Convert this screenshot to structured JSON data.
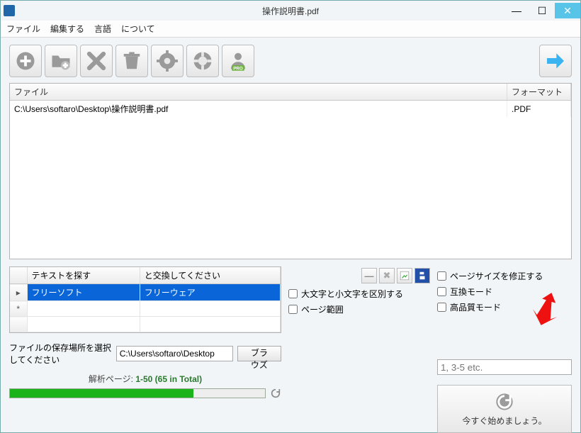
{
  "window": {
    "title": "操作説明書.pdf"
  },
  "menubar": {
    "file": "ファイル",
    "edit": "編集する",
    "language": "言語",
    "about": "について"
  },
  "toolbar_icons": {
    "add": "add-icon",
    "add_folder": "add-folder-icon",
    "remove": "remove-icon",
    "trash": "trash-icon",
    "settings": "gear-icon",
    "help": "lifebuoy-icon",
    "pro": "pro-icon",
    "next": "arrow-right-icon"
  },
  "file_list": {
    "columns": {
      "file": "ファイル",
      "format": "フォーマット"
    },
    "rows": [
      {
        "file": "C:\\Users\\softaro\\Desktop\\操作説明書.pdf",
        "format": ".PDF"
      }
    ]
  },
  "replace": {
    "columns": {
      "find": "テキストを探す",
      "replace_with": "と交換してください"
    },
    "rows": [
      {
        "marker": "▸",
        "find": "フリーソフト",
        "replace_with": "フリーウェア",
        "selected": true
      },
      {
        "marker": "*",
        "find": "",
        "replace_with": "",
        "selected": false
      }
    ]
  },
  "mini_toolbar": {
    "minus": "−",
    "delete": "✖",
    "add_row": "＋",
    "save": "💾"
  },
  "options": {
    "case_sensitive": "大文字と小文字を区別する",
    "page_range": "ページ範囲",
    "fix_page_size": "ページサイズを修正する",
    "compat_mode": "互換モード",
    "hq_mode": "高品質モード",
    "page_range_placeholder": "1, 3-5 etc."
  },
  "save_location": {
    "label": "ファイルの保存場所を選択してください",
    "path": "C:\\Users\\softaro\\Desktop",
    "browse": "ブラウズ"
  },
  "analysis": {
    "label": "解析ページ:",
    "value": "1-50 (65 in Total)"
  },
  "start": {
    "label": "今すぐ始めましょう。"
  }
}
